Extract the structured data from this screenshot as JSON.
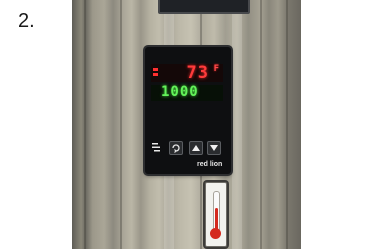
{
  "step_label": "2.",
  "controller": {
    "process_value": "73",
    "unit": "F",
    "setpoint_value": "1000",
    "brand": "red lion",
    "buttons": {
      "mode_icon": "mode-icon",
      "cycle_icon": "cycle-arrows-icon",
      "up_icon": "triangle-up-icon",
      "down_icon": "triangle-down-icon"
    }
  },
  "thermometer": {
    "level": 0.6,
    "fluid_color": "#d42a1e"
  },
  "colors": {
    "temperature_display": "#ff3b3b",
    "setpoint_display": "#63f25a",
    "controller_body": "#0e0f11"
  }
}
